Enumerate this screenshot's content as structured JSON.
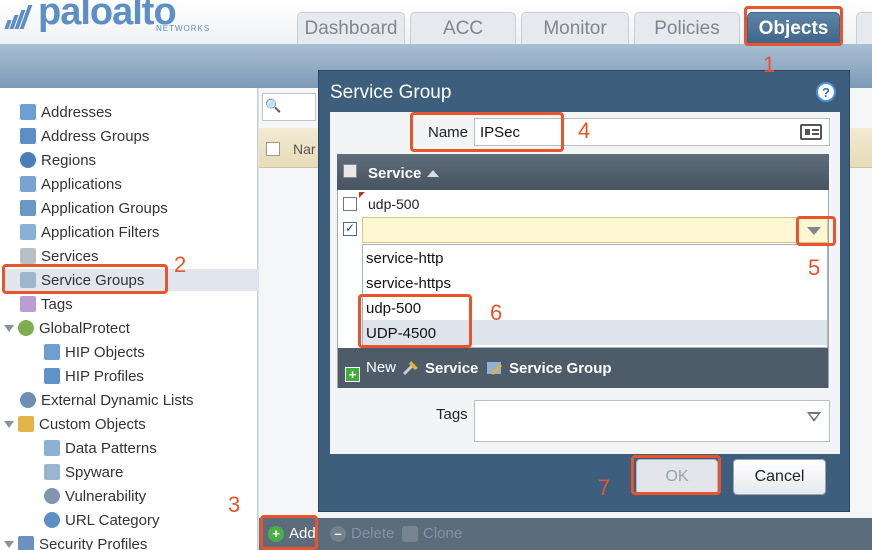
{
  "app": {
    "logo_text": "paloalto",
    "logo_sub": "NETWORKS"
  },
  "tabs": [
    {
      "label": "Dashboard",
      "active": false
    },
    {
      "label": "ACC",
      "active": false
    },
    {
      "label": "Monitor",
      "active": false
    },
    {
      "label": "Policies",
      "active": false
    },
    {
      "label": "Objects",
      "active": true
    }
  ],
  "sidebar": {
    "items": [
      {
        "label": "Addresses",
        "icon": "addresses-icon"
      },
      {
        "label": "Address Groups",
        "icon": "address-groups-icon"
      },
      {
        "label": "Regions",
        "icon": "regions-icon"
      },
      {
        "label": "Applications",
        "icon": "applications-icon"
      },
      {
        "label": "Application Groups",
        "icon": "application-groups-icon"
      },
      {
        "label": "Application Filters",
        "icon": "application-filters-icon"
      },
      {
        "label": "Services",
        "icon": "services-icon"
      },
      {
        "label": "Service Groups",
        "icon": "service-groups-icon",
        "selected": true
      },
      {
        "label": "Tags",
        "icon": "tags-icon"
      },
      {
        "label": "GlobalProtect",
        "icon": "globalprotect-icon",
        "expandable": true
      },
      {
        "label": "HIP Objects",
        "icon": "hip-objects-icon"
      },
      {
        "label": "HIP Profiles",
        "icon": "hip-profiles-icon"
      },
      {
        "label": "External Dynamic Lists",
        "icon": "external-dynamic-lists-icon"
      },
      {
        "label": "Custom Objects",
        "icon": "custom-objects-icon",
        "expandable": true
      },
      {
        "label": "Data Patterns",
        "icon": "data-patterns-icon"
      },
      {
        "label": "Spyware",
        "icon": "spyware-icon"
      },
      {
        "label": "Vulnerability",
        "icon": "vulnerability-icon"
      },
      {
        "label": "URL Category",
        "icon": "url-category-icon"
      },
      {
        "label": "Security Profiles",
        "icon": "security-profiles-icon",
        "expandable": true
      }
    ]
  },
  "grid": {
    "column_name": "Nar"
  },
  "bottom_bar": {
    "add_label": "Add",
    "delete_label": "Delete",
    "clone_label": "Clone"
  },
  "dialog": {
    "title": "Service Group",
    "name_label": "Name",
    "name_value": "IPSec",
    "table_header": "Service",
    "rows": [
      {
        "value": "udp-500",
        "checked": false
      },
      {
        "value": "",
        "checked": true
      }
    ],
    "dropdown_options": [
      "service-http",
      "service-https",
      "udp-500",
      "UDP-4500"
    ],
    "new_label": "New",
    "new_service_label": "Service",
    "new_service_group_label": "Service Group",
    "tags_label": "Tags",
    "ok_label": "OK",
    "cancel_label": "Cancel"
  },
  "annotations": [
    "1",
    "2",
    "3",
    "4",
    "5",
    "6",
    "7"
  ],
  "colors": {
    "accent": "#e8542b",
    "active_tab": "#4a7097",
    "dialog_frame": "#3e5e7d",
    "brand": "#5d8fc4"
  }
}
